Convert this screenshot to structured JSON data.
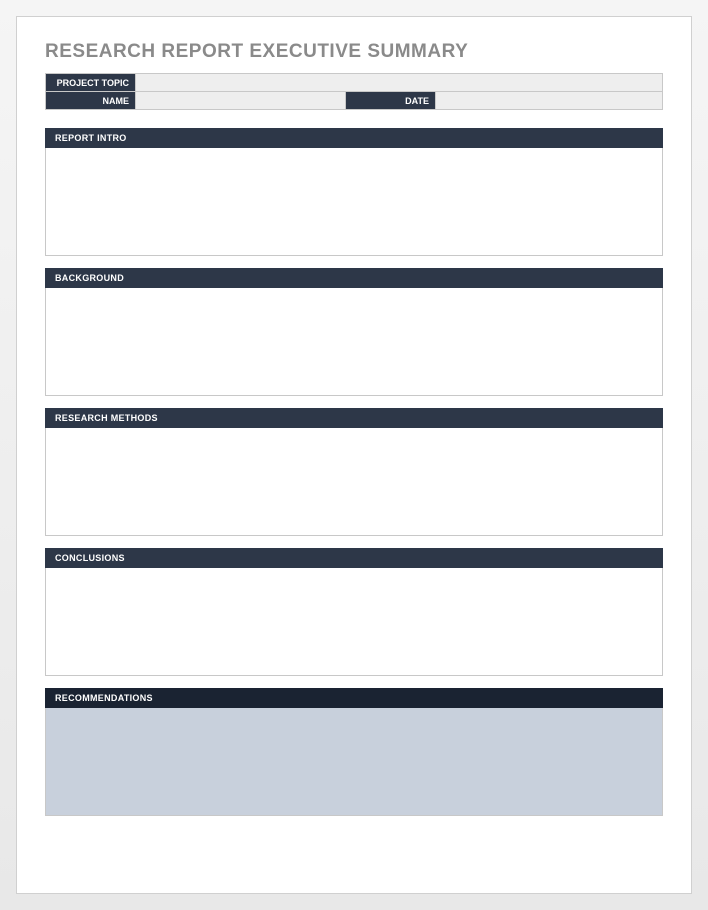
{
  "title": "RESEARCH REPORT EXECUTIVE SUMMARY",
  "meta": {
    "project_topic_label": "PROJECT TOPIC",
    "project_topic_value": "",
    "name_label": "NAME",
    "name_value": "",
    "date_label": "DATE",
    "date_value": ""
  },
  "sections": {
    "report_intro": {
      "label": "REPORT INTRO",
      "content": ""
    },
    "background": {
      "label": "BACKGROUND",
      "content": ""
    },
    "research_methods": {
      "label": "RESEARCH METHODS",
      "content": ""
    },
    "conclusions": {
      "label": "CONCLUSIONS",
      "content": ""
    },
    "recommendations": {
      "label": "RECOMMENDATIONS",
      "content": ""
    }
  }
}
